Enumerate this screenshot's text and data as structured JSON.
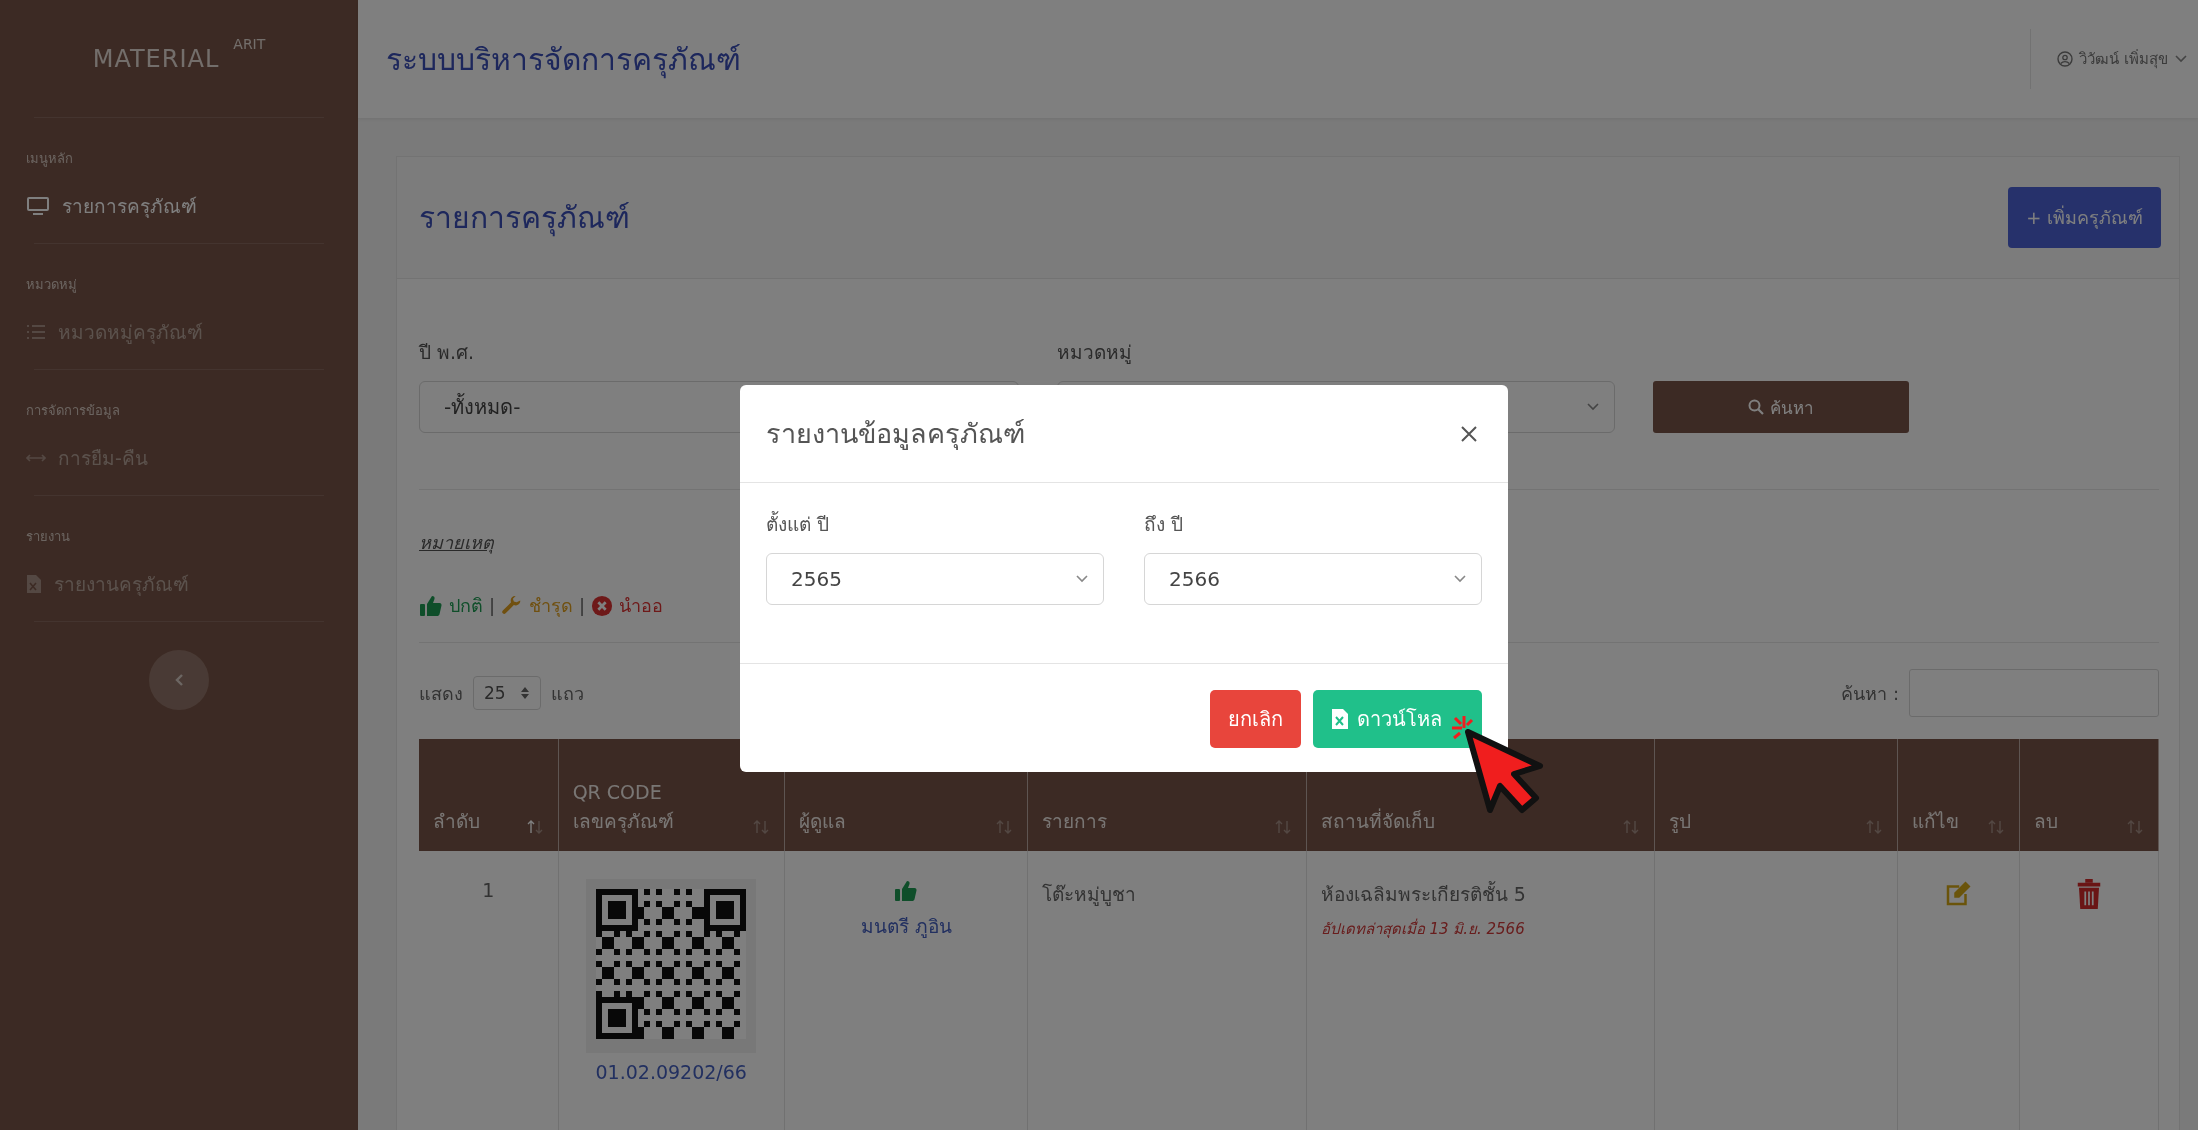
{
  "sidebar": {
    "logo": "MATERIAL",
    "logo_sup": "ARIT",
    "sections": [
      {
        "heading": "เมนูหลัก",
        "items": [
          {
            "label": "รายการครุภัณฑ์",
            "selected": true
          }
        ]
      },
      {
        "heading": "หมวดหมู่",
        "items": [
          {
            "label": "หมวดหมู่ครุภัณฑ์",
            "selected": false
          }
        ]
      },
      {
        "heading": "การจัดการข้อมูล",
        "items": [
          {
            "label": "การยืม-คืน",
            "selected": false
          }
        ]
      },
      {
        "heading": "รายงาน",
        "items": [
          {
            "label": "รายงานครุภัณฑ์",
            "selected": false
          }
        ]
      }
    ]
  },
  "header": {
    "title": "ระบบบริหารจัดการครุภัณฑ์",
    "user": "วิวัฒน์ เพิ่มสุข"
  },
  "card": {
    "title": "รายการครุภัณฑ์",
    "add_button": "+ เพิ่มครุภัณฑ์",
    "filters": [
      {
        "label": "ปี พ.ศ.",
        "value": "-ทั้งหมด-"
      },
      {
        "label": "หมวดหมู่"
      }
    ],
    "search_button": "ค้นหา",
    "legend": {
      "title": "หมายเหตุ",
      "separator": "|",
      "items": [
        {
          "kind": "normal",
          "label": "ปกติ"
        },
        {
          "kind": "damaged",
          "label": "ชำรุด"
        },
        {
          "kind": "removed",
          "label": "นำออ"
        }
      ]
    },
    "page_size": {
      "prefix": "แสดง",
      "value": "25",
      "suffix": "แถว"
    },
    "table_search": {
      "label": "ค้นหา :"
    }
  },
  "table": {
    "columns": [
      {
        "lines": [
          "ลำดับ"
        ],
        "sorted": true
      },
      {
        "lines": [
          "QR CODE",
          "เลขครุภัณฑ์"
        ],
        "sorted": false
      },
      {
        "lines": [
          "ผู้ดูแล"
        ],
        "sorted": false
      },
      {
        "lines": [
          "รายการ"
        ],
        "sorted": false
      },
      {
        "lines": [
          "สถานที่จัดเก็บ"
        ],
        "sorted": false
      },
      {
        "lines": [
          "รูป"
        ],
        "sorted": false
      },
      {
        "lines": [
          "แก้ไข"
        ],
        "sorted": false
      },
      {
        "lines": [
          "ลบ"
        ],
        "sorted": false
      }
    ],
    "rows": [
      {
        "index": "1",
        "asset_no": "01.02.09202/66",
        "kind": "normal",
        "keeper": "มนตรี ภูอิน",
        "item": "โต๊ะหมู่บูชา",
        "location": "ห้องเฉลิมพระเกียรติชั้น 5",
        "updated": "อัปเดทล่าสุดเมื่อ 13 มิ.ย. 2566"
      }
    ]
  },
  "modal": {
    "title": "รายงานข้อมูลครุภัณฑ์",
    "fields": [
      {
        "label": "ตั้งแต่ ปี",
        "value": "2565"
      },
      {
        "label": "ถึง ปี",
        "value": "2566"
      }
    ],
    "buttons": [
      {
        "kind": "cancel",
        "label": "ยกเลิก"
      },
      {
        "kind": "download",
        "label": "ดาวน์โหล"
      }
    ]
  }
}
